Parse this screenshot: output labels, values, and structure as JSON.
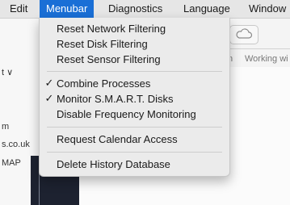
{
  "menubar": {
    "items": [
      {
        "label": "Edit"
      },
      {
        "label": "Menubar"
      },
      {
        "label": "Diagnostics"
      },
      {
        "label": "Language"
      },
      {
        "label": "Window"
      }
    ]
  },
  "background": {
    "left_texts": [
      "t ∨",
      "m",
      "s.co.uk",
      "MAP"
    ],
    "right_texts": [
      "n",
      "Working wi"
    ]
  },
  "dropdown": {
    "items": [
      {
        "label": "Reset Network Filtering",
        "check": ""
      },
      {
        "label": "Reset Disk Filtering",
        "check": ""
      },
      {
        "label": "Reset Sensor Filtering",
        "check": ""
      },
      {
        "label": "Combine Processes",
        "check": "✓"
      },
      {
        "label": "Monitor S.M.A.R.T. Disks",
        "check": "✓"
      },
      {
        "label": "Disable Frequency Monitoring",
        "check": ""
      },
      {
        "label": "Request Calendar Access",
        "check": ""
      },
      {
        "label": "Delete History Database",
        "check": ""
      }
    ]
  }
}
